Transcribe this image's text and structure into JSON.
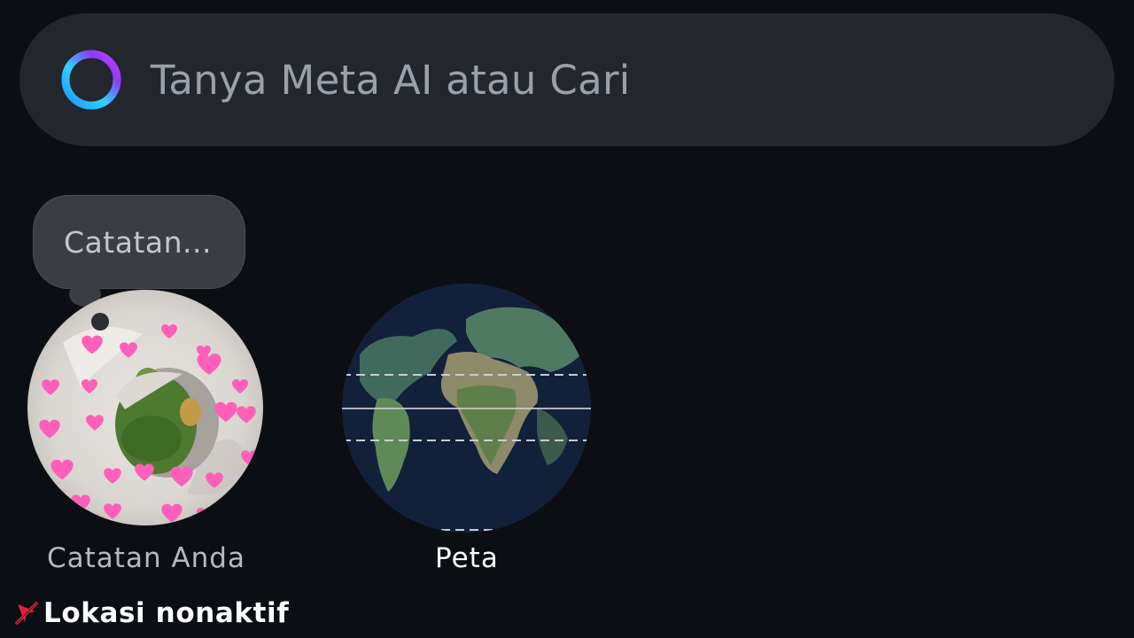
{
  "search": {
    "placeholder": "Tanya Meta AI atau Cari",
    "icon": "meta-ai-ring-icon"
  },
  "notes": {
    "bubble_text": "Catatan...",
    "label": "Catatan Anda",
    "avatar": "avatar-frog-blanket-with-hearts"
  },
  "map": {
    "label": "Peta",
    "thumbnail": "world-globe-icon"
  },
  "location": {
    "status_text": "Lokasi nonaktif",
    "icon": "location-off-icon",
    "icon_color": "#e0213a"
  },
  "colors": {
    "background": "#0b0e12",
    "search_bar": "#23272d",
    "bubble": "#3a3d42"
  }
}
